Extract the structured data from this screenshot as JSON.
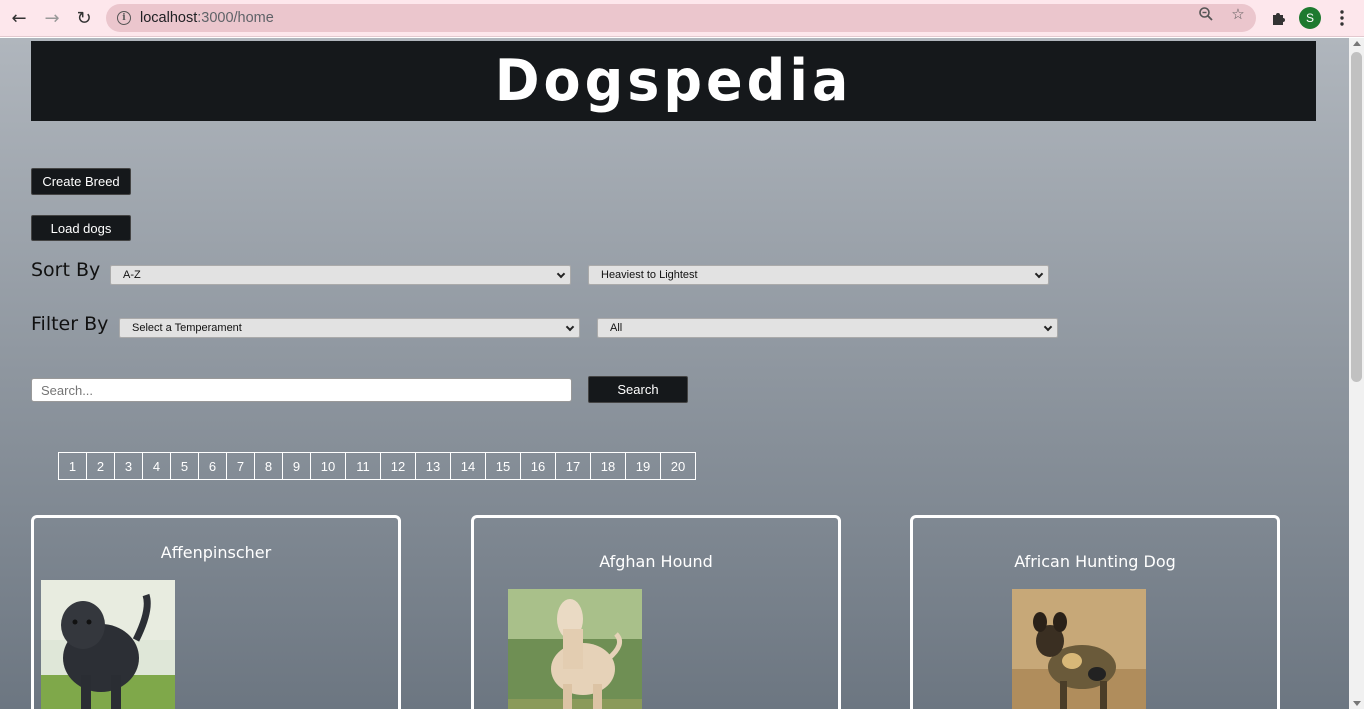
{
  "browser": {
    "url_host": "localhost",
    "url_path": ":3000/home",
    "avatar_letter": "S"
  },
  "header": {
    "logo": "Dogspedia"
  },
  "actions": {
    "create_breed": "Create Breed",
    "load_dogs": "Load dogs"
  },
  "sort": {
    "label": "Sort By",
    "alpha_selected": "A-Z",
    "weight_selected": "Heaviest to Lightest"
  },
  "filter": {
    "label": "Filter By",
    "temperament_selected": "Select a Temperament",
    "origin_selected": "All"
  },
  "search": {
    "placeholder": "Search...",
    "button": "Search"
  },
  "pagination": {
    "pages": [
      "1",
      "2",
      "3",
      "4",
      "5",
      "6",
      "7",
      "8",
      "9",
      "10",
      "11",
      "12",
      "13",
      "14",
      "15",
      "16",
      "17",
      "18",
      "19",
      "20"
    ]
  },
  "cards": [
    {
      "name": "Affenpinscher"
    },
    {
      "name": "Afghan Hound"
    },
    {
      "name": "African Hunting Dog"
    }
  ],
  "colors": {
    "header_bg": "#15181b",
    "chrome_bg": "#fde7ec",
    "gradient_top": "#b0b6bd",
    "gradient_bottom": "#6c7681"
  }
}
